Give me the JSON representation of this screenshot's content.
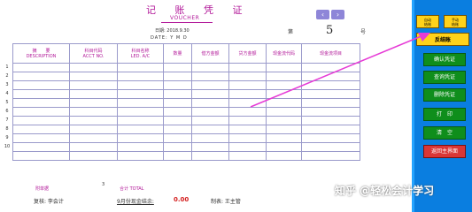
{
  "voucher": {
    "title": "记 账 凭 证",
    "subtitle": "VOUCHER",
    "date_label": "日期:",
    "date_value": "2018.9.30",
    "date_en": "DATE:  Y  M  D",
    "number_label": "第",
    "number_value": "5",
    "number_suffix": "号",
    "prev_icon": "chevron-left",
    "next_icon": "chevron-right"
  },
  "table": {
    "headers": [
      "摘　　要\nDESCRIPTION",
      "科目代码\nACCT NO.",
      "科目名称\nLED. A/C",
      "数量",
      "借方金额",
      "贷方金额",
      "现金流代码",
      "现金流项目"
    ],
    "row_numbers": [
      "1",
      "2",
      "3",
      "4",
      "5",
      "6",
      "7",
      "8",
      "9",
      "10"
    ]
  },
  "footer": {
    "attach_label": "附单据",
    "attach_count": "3",
    "total_label": "合计  TOTAL",
    "reviewer": "复核: 李会计",
    "cash_balance_label": "9月份现金结余:",
    "cash_balance_value": "0.00",
    "maker": "制表: 王主管"
  },
  "sidebar": {
    "auto_hook": "自动\n结账",
    "manual_hook": "手动\n结账",
    "reverse": "反结账",
    "buttons": [
      "确认凭证",
      "查询凭证",
      "删除凭证",
      "打　印",
      "清　空"
    ],
    "return": "返回主界面"
  },
  "watermark": "知乎 @轻松会计学习",
  "colors": {
    "accent": "#b21899",
    "sidebar": "#0a7ee0",
    "button_green": "#0f8e1c",
    "button_red": "#d93636",
    "highlight": "#ffd21a"
  }
}
